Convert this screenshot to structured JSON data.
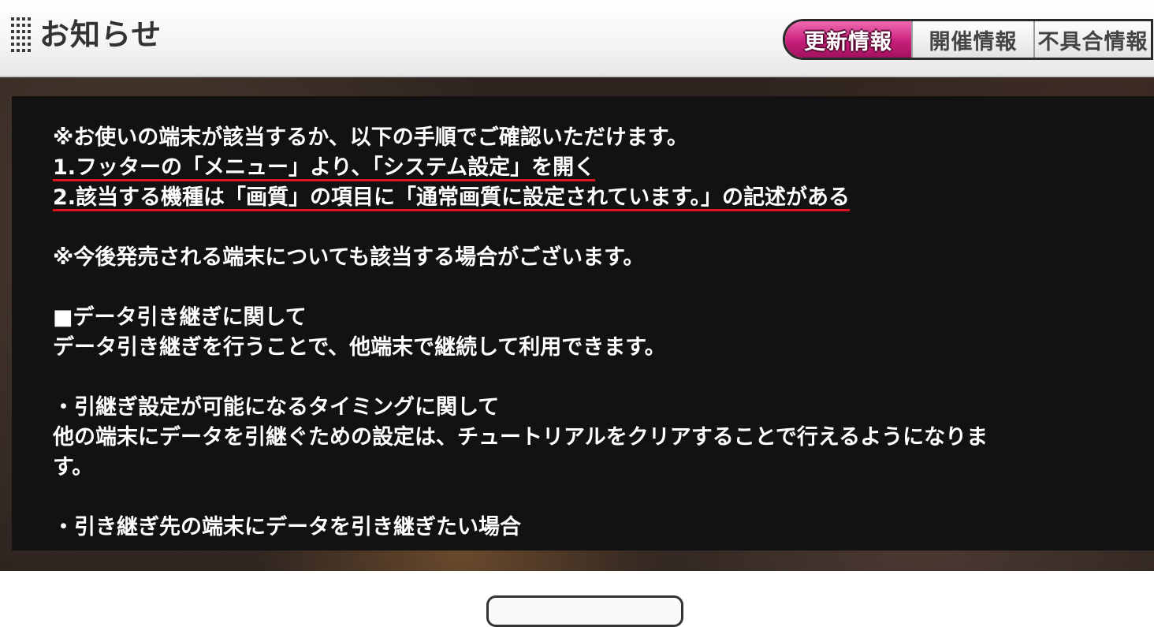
{
  "header": {
    "title": "お知らせ",
    "tabs": [
      {
        "label": "更新情報",
        "active": true
      },
      {
        "label": "開催情報",
        "active": false
      },
      {
        "label": "不具合情報",
        "active": false
      }
    ]
  },
  "notice": {
    "lines": [
      "※お使いの端末が該当するか、以下の手順でご確認いただけます。",
      "1.フッターの「メニュー」より、「システム設定」を開く",
      "2.該当する機種は「画質」の項目に「通常画質に設定されています。」の記述がある",
      "※今後発売される端末についても該当する場合がございます。",
      "■データ引き継ぎに関して",
      "データ引き継ぎを行うことで、他端末で継続して利用できます。",
      "・引継ぎ設定が可能になるタイミングに関して",
      "他の端末にデータを引継ぐための設定は、チュートリアルをクリアすることで行えるようになりま",
      "す。",
      "・引き継ぎ先の端末にデータを引き継ぎたい場合"
    ]
  },
  "colors": {
    "active_tab": "#c8207b",
    "panel_bg": "#121212",
    "underline": "#e0141e"
  }
}
